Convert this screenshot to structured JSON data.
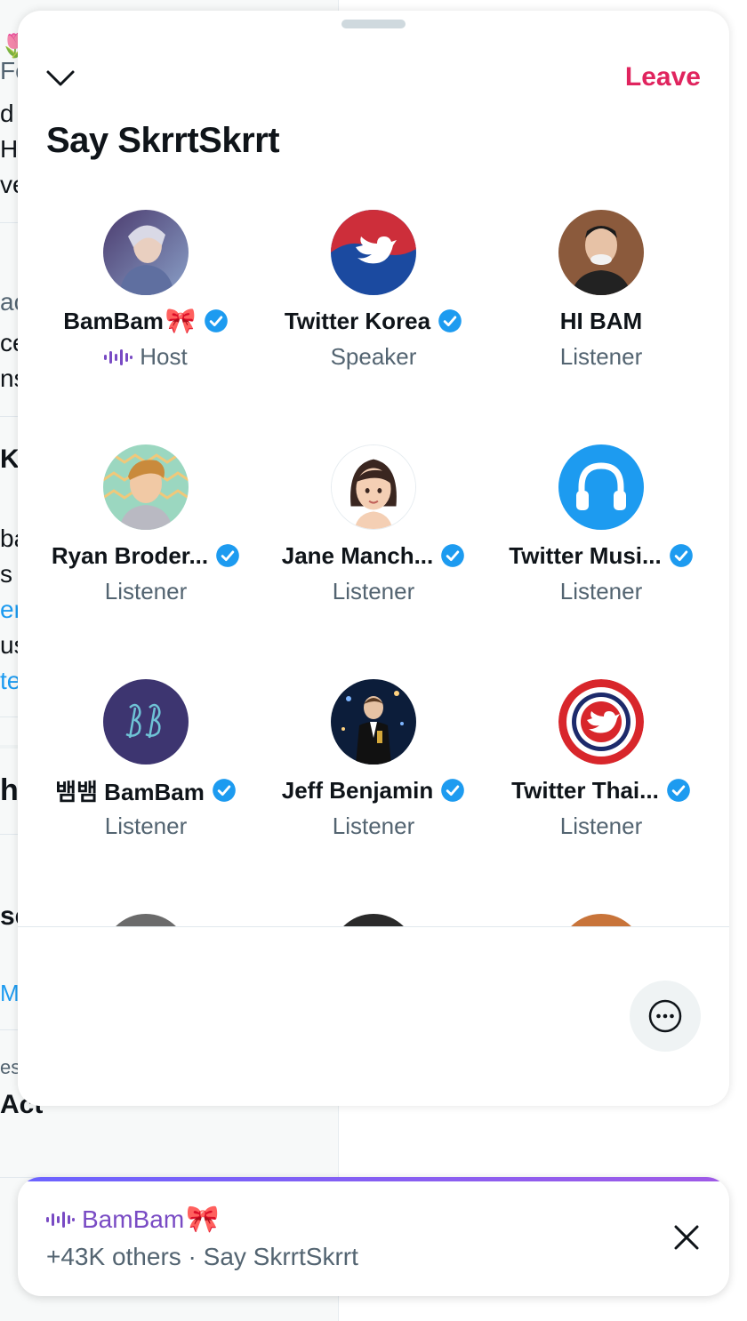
{
  "background": {
    "fragments": [
      "Fo",
      "d",
      "H",
      "ve",
      "ac",
      "ce",
      "ns",
      "K",
      "ba",
      "s",
      "er",
      "us",
      "te",
      "hi",
      "se",
      "M",
      "es",
      "Act"
    ]
  },
  "sheet": {
    "title": "Say SkrrtSkrrt",
    "leave_label": "Leave",
    "collapse_icon": "chevron-down-icon",
    "more_icon": "more-horizontal-icon"
  },
  "participants": [
    {
      "name": "BamBam",
      "ribbon": "🎀",
      "verified": true,
      "role": "Host"
    },
    {
      "name": "Twitter Korea",
      "verified": true,
      "role": "Speaker"
    },
    {
      "name": "HI BAM",
      "verified": false,
      "role": "Listener"
    },
    {
      "name": "Ryan Broder...",
      "verified": true,
      "role": "Listener"
    },
    {
      "name": "Jane Manch...",
      "verified": true,
      "role": "Listener"
    },
    {
      "name": "Twitter Musi...",
      "verified": true,
      "role": "Listener"
    },
    {
      "name": "뱀뱀 BamBam",
      "verified": true,
      "role": "Listener"
    },
    {
      "name": "Jeff Benjamin",
      "verified": true,
      "role": "Listener"
    },
    {
      "name": "Twitter Thai...",
      "verified": true,
      "role": "Listener"
    }
  ],
  "mini_player": {
    "host_name": "BamBam",
    "ribbon": "🎀",
    "subtitle": "+43K others · Say SkrrtSkrrt",
    "close_icon": "close-icon"
  },
  "colors": {
    "leave": "#e0245e",
    "verified": "#1d9bf0",
    "host_purple": "#794bc4",
    "secondary_text": "#536471"
  }
}
